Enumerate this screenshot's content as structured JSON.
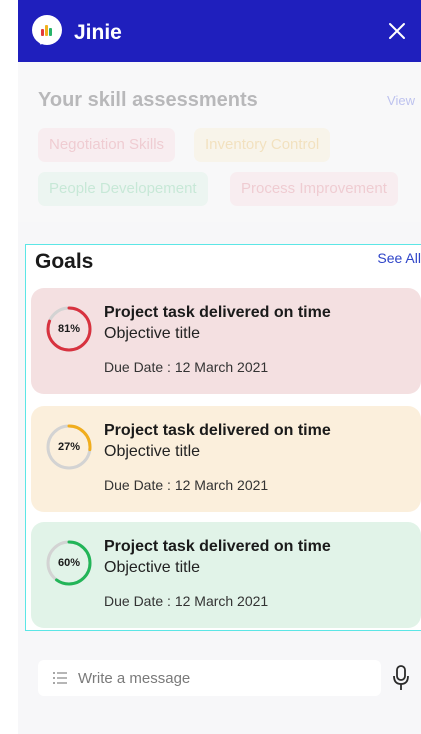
{
  "header": {
    "title": "Jinie",
    "logo_icon": "jinie-chat-bubble-icon",
    "close_icon": "close-icon",
    "background": "#1f1fbd"
  },
  "skills": {
    "title": "Your skill assessments",
    "view_label": "View",
    "chips": [
      {
        "label": "Negotiation Skills",
        "bg": "#fbd9dc",
        "color": "#e06b7a"
      },
      {
        "label": "Inventory Control",
        "bg": "#fdeec9",
        "color": "#e9b23d"
      },
      {
        "label": "People Developement",
        "bg": "#d5f2df",
        "color": "#5cc98b"
      },
      {
        "label": "Process Improvement",
        "bg": "#fbd9dc",
        "color": "#e06b7a"
      }
    ]
  },
  "goals": {
    "title": "Goals",
    "see_all_label": "See All",
    "items": [
      {
        "percent": 81,
        "percent_label": "81%",
        "title": "Project task delivered on time",
        "subtitle": "Objective title",
        "due": "Due Date : 12 March 2021",
        "card_bg": "#f4e0e1",
        "ring_color": "#d8323f"
      },
      {
        "percent": 27,
        "percent_label": "27%",
        "title": "Project task delivered on time",
        "subtitle": "Objective title",
        "due": "Due Date : 12 March 2021",
        "card_bg": "#fbefdc",
        "ring_color": "#f1ad1c"
      },
      {
        "percent": 60,
        "percent_label": "60%",
        "title": "Project task delivered on time",
        "subtitle": "Objective title",
        "due": "Due Date : 12 March 2021",
        "card_bg": "#e1f3e8",
        "ring_color": "#22b558"
      }
    ]
  },
  "composer": {
    "placeholder": "Write a message",
    "value": "",
    "list_icon": "list-icon",
    "mic_icon": "microphone-icon"
  }
}
